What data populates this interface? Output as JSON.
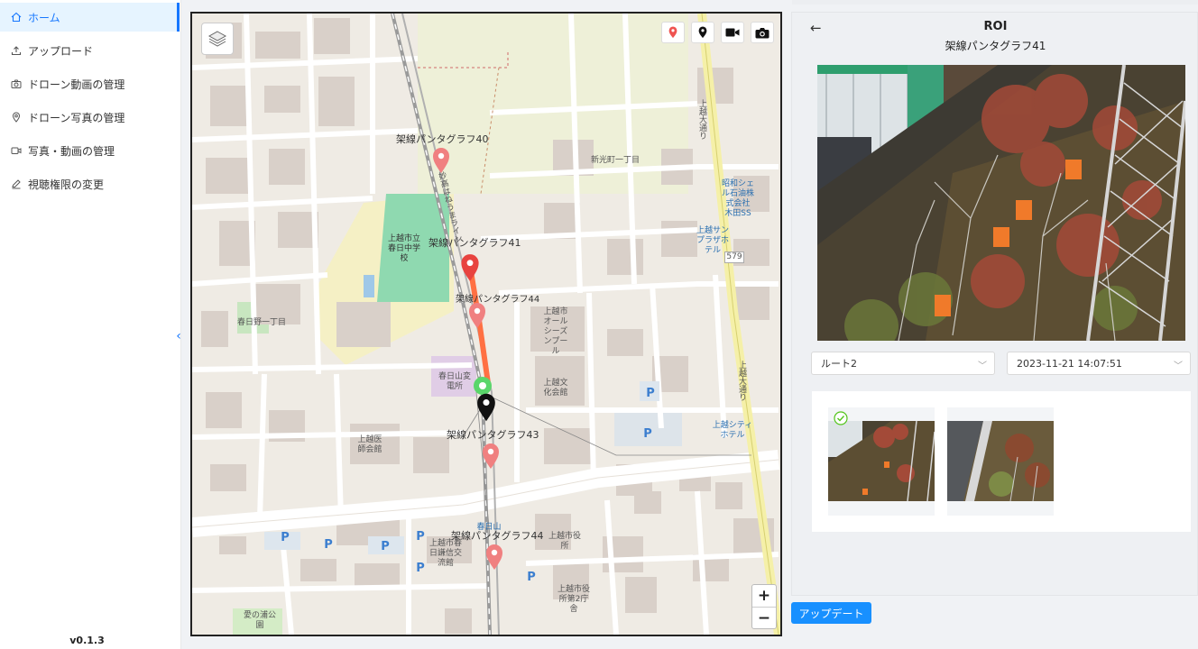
{
  "sidebar": {
    "items": [
      {
        "label": "ホーム",
        "icon": "home-icon"
      },
      {
        "label": "アップロード",
        "icon": "upload-icon"
      },
      {
        "label": "ドローン動画の管理",
        "icon": "camera-icon"
      },
      {
        "label": "ドローン写真の管理",
        "icon": "location-icon"
      },
      {
        "label": "写真・動画の管理",
        "icon": "video-icon"
      },
      {
        "label": "視聴権限の変更",
        "icon": "edit-icon"
      }
    ],
    "active_index": 0,
    "version": "v0.1.3",
    "accent": "#1677ff"
  },
  "map": {
    "markers": [
      {
        "label": "架線パンタグラフ40",
        "color": "#f08080"
      },
      {
        "label": "架線パンタグラフ41",
        "color": "#e8433f"
      },
      {
        "label": "架線パンタグラフ43",
        "color": "#f08080"
      },
      {
        "label": "架線パンタグラフ44",
        "color": "#f08080"
      }
    ],
    "overlap_label": "架線パンタグラフ44",
    "places": {
      "school": "上越市立\n春日中学\n校",
      "kasugano": "春日野一丁目",
      "shinkocho": "新光町一丁目",
      "allseasons": "上越市\nオール\nシーズ\nンプー\nル",
      "bunka": "上越文\n化会館",
      "ishikai": "上越医\n師会館",
      "kasugayama_shrine": "春日山変\n電所",
      "showa": "昭和シェ\nル石油株\n式会社\n木田SS",
      "sunplaza": "上越サン\nプラザホ\nテル",
      "cityhotel": "上越シティ\nホテル",
      "cityhall": "上越市役\n所",
      "cityhall2": "上越市役\n所第2庁\n舎",
      "koryukan": "上越市春\n日謙信交\n流館",
      "park": "愛の浦公\n園",
      "station": "春日山",
      "route579": "579",
      "avenue": "上越大通り",
      "line_label": "妙高はねうまライン"
    },
    "tools": [
      "location-pin-red-icon",
      "location-pin-black-icon",
      "video-camera-icon",
      "camera-icon"
    ],
    "zoom_in": "+",
    "zoom_out": "−"
  },
  "panel": {
    "title": "ROI",
    "subtitle": "架線パンタグラフ41",
    "route_select": "ルート2",
    "datetime_select": "2023-11-21 14:07:51",
    "thumbnail_count": 2,
    "selected_thumbnail": 0
  },
  "update_button": "アップデート"
}
